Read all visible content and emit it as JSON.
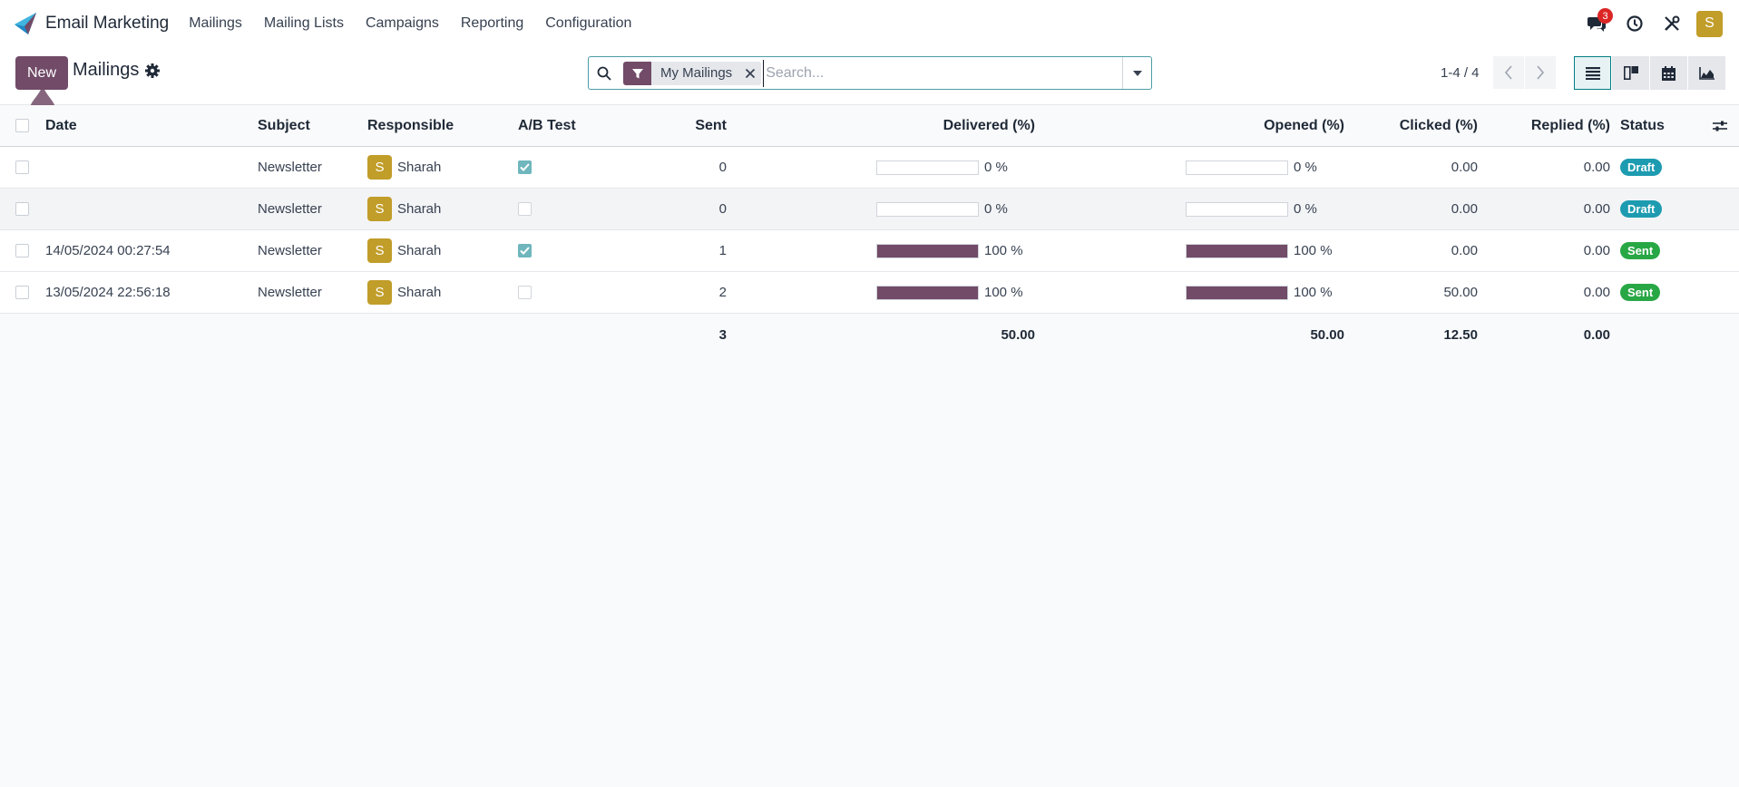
{
  "app": {
    "name": "Email Marketing"
  },
  "menu": [
    "Mailings",
    "Mailing Lists",
    "Campaigns",
    "Reporting",
    "Configuration"
  ],
  "nav_right": {
    "messages_count": "3",
    "user_initial": "S"
  },
  "control": {
    "new_label": "New",
    "title": "Mailings",
    "facet": "My Mailings",
    "search_placeholder": "Search...",
    "pager": "1-4 / 4"
  },
  "columns": {
    "date": "Date",
    "subject": "Subject",
    "responsible": "Responsible",
    "ab_test": "A/B Test",
    "sent": "Sent",
    "delivered": "Delivered (%)",
    "opened": "Opened (%)",
    "clicked": "Clicked (%)",
    "replied": "Replied (%)",
    "status": "Status"
  },
  "rows": [
    {
      "date": "",
      "subject": "Newsletter",
      "responsible": "Sharah",
      "avatar": "S",
      "ab_test": true,
      "sent": "0",
      "delivered": 0,
      "delivered_label": "0 %",
      "opened": 0,
      "opened_label": "0 %",
      "clicked": "0.00",
      "replied": "0.00",
      "status": "Draft",
      "status_color": "#1d9bb0"
    },
    {
      "date": "",
      "subject": "Newsletter",
      "responsible": "Sharah",
      "avatar": "S",
      "ab_test": false,
      "sent": "0",
      "delivered": 0,
      "delivered_label": "0 %",
      "opened": 0,
      "opened_label": "0 %",
      "clicked": "0.00",
      "replied": "0.00",
      "status": "Draft",
      "status_color": "#1d9bb0"
    },
    {
      "date": "14/05/2024 00:27:54",
      "subject": "Newsletter",
      "responsible": "Sharah",
      "avatar": "S",
      "ab_test": true,
      "sent": "1",
      "delivered": 100,
      "delivered_label": "100 %",
      "opened": 100,
      "opened_label": "100 %",
      "clicked": "0.00",
      "replied": "0.00",
      "status": "Sent",
      "status_color": "#28a745"
    },
    {
      "date": "13/05/2024 22:56:18",
      "subject": "Newsletter",
      "responsible": "Sharah",
      "avatar": "S",
      "ab_test": false,
      "sent": "2",
      "delivered": 100,
      "delivered_label": "100 %",
      "opened": 100,
      "opened_label": "100 %",
      "clicked": "50.00",
      "replied": "0.00",
      "status": "Sent",
      "status_color": "#28a745"
    }
  ],
  "totals": {
    "sent": "3",
    "delivered": "50.00",
    "opened": "50.00",
    "clicked": "12.50",
    "replied": "0.00"
  },
  "colors": {
    "brand": "#714b67",
    "accent": "#017e84"
  },
  "icons": {
    "logo": "email-marketing-logo-icon",
    "messages": "chat-bubbles-icon",
    "activity": "clock-icon",
    "debug": "tools-icon",
    "gear": "gear-icon",
    "search": "search-icon",
    "filter": "filter-icon",
    "remove": "close-icon",
    "dropdown": "caret-down-icon",
    "prev": "chevron-left-icon",
    "next": "chevron-right-icon",
    "list": "list-view-icon",
    "kanban": "kanban-view-icon",
    "calendar": "calendar-view-icon",
    "graph": "graph-view-icon",
    "optional_columns": "sliders-icon"
  }
}
